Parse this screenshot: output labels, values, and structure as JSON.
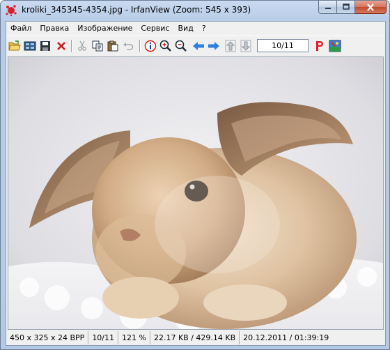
{
  "window": {
    "title": "kroliki_345345-4354.jpg - IrfanView (Zoom: 545 x 393)"
  },
  "menu": [
    "Файл",
    "Правка",
    "Изображение",
    "Сервис",
    "Вид",
    "?"
  ],
  "toolbar": {
    "page_indicator": "10/11",
    "icons": [
      "open-folder-icon",
      "thumbnails-icon",
      "save-icon",
      "delete-icon",
      "cut-icon",
      "copy-icon",
      "paste-icon",
      "undo-icon",
      "info-icon",
      "zoom-in-icon",
      "zoom-out-icon",
      "previous-icon",
      "next-icon",
      "first-icon",
      "last-icon",
      "print-p-icon",
      "paint-icon"
    ]
  },
  "statusbar": {
    "dimensions": "450 x 325 x 24 BPP",
    "index": "10/11",
    "zoom": "121 %",
    "size": "22.17 KB / 429.14 KB",
    "datetime": "20.12.2011 / 01:39:19"
  },
  "colors": {
    "title_bar": "#c4d6ee",
    "close_button": "#c94c31",
    "arrow_blue": "#2d7fe0",
    "print_red": "#e0202a"
  }
}
